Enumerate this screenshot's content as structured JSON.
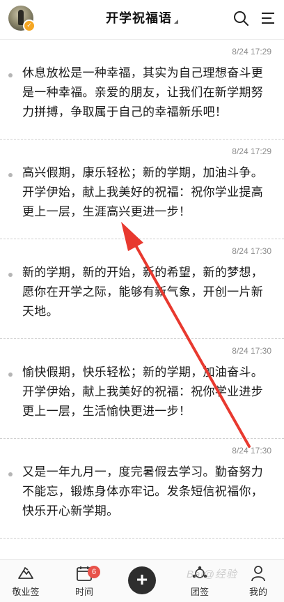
{
  "header": {
    "title": "开学祝福语",
    "avatar_badge": "✓"
  },
  "entries": [
    {
      "time": "8/24 17:29",
      "text": "休息放松是一种幸福，其实为自己理想奋斗更是一种幸福。亲爱的朋友，让我们在新学期努力拼搏，争取属于自己的幸福新乐吧！"
    },
    {
      "time": "8/24 17:29",
      "text": "高兴假期，康乐轻松；新的学期，加油斗争。开学伊始，献上我美好的祝福：祝你学业提高更上一层，生涯高兴更进一步！"
    },
    {
      "time": "8/24 17:30",
      "text": "新的学期，新的开始，新的希望，新的梦想，愿你在开学之际，能够有新气象，开创一片新天地。"
    },
    {
      "time": "8/24 17:30",
      "text": "愉快假期，快乐轻松；新的学期，加油奋斗。开学伊始，献上我美好的祝福：祝你学业进步更上一层，生活愉快更进一步！"
    },
    {
      "time": "8/24 17:30",
      "text": "又是一年九月一，度完暑假去学习。勤奋努力不能忘，锻炼身体亦牢记。发条短信祝福你，快乐开心新学期。"
    }
  ],
  "bottom_nav": {
    "items": [
      {
        "label": "敬业签",
        "icon": "mountain-icon"
      },
      {
        "label": "时间",
        "icon": "calendar-icon",
        "badge": "6"
      },
      {
        "label": "团签",
        "icon": "group-icon"
      },
      {
        "label": "我的",
        "icon": "person-icon"
      }
    ],
    "add_label": "+"
  },
  "watermark": "Bai@经验",
  "colors": {
    "annotation_arrow": "#e8392f",
    "badge": "#e8524a",
    "avatar_badge": "#f5a623"
  }
}
